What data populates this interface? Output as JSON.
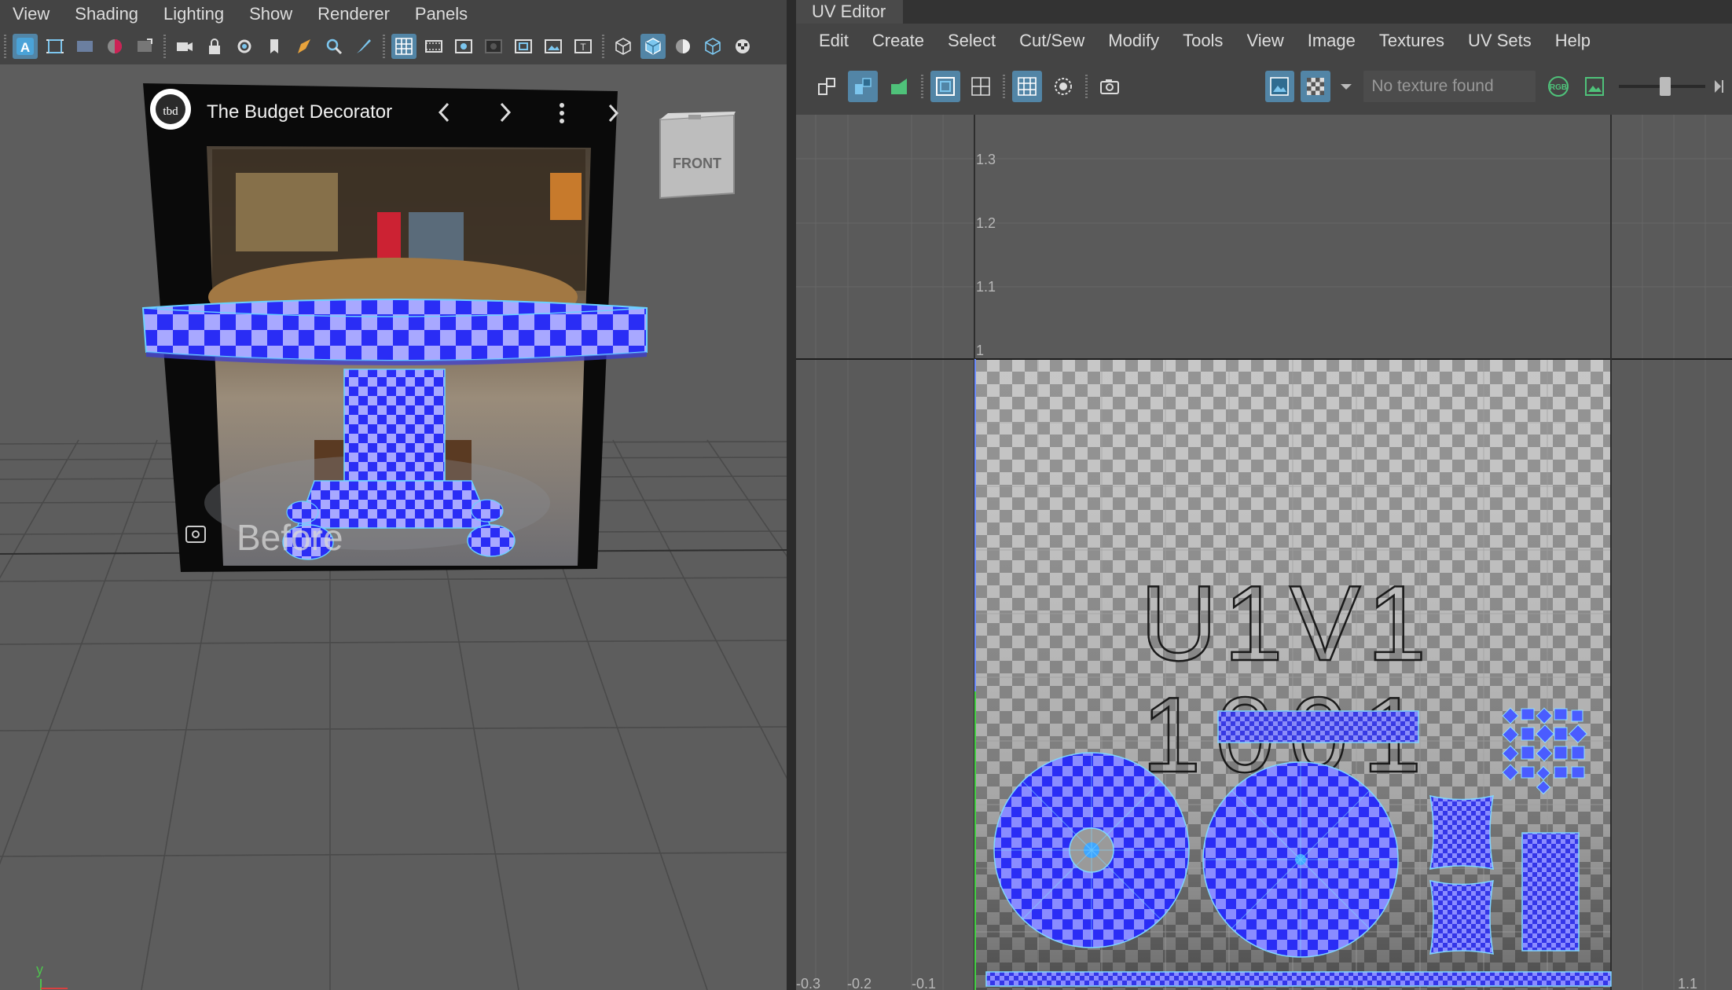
{
  "left_panel": {
    "menu": [
      "View",
      "Shading",
      "Lighting",
      "Show",
      "Renderer",
      "Panels"
    ],
    "image_plane": {
      "channel_title": "The Budget Decorator",
      "channel_logo": "tbd",
      "overlay_text": "Before"
    },
    "view_cube_label": "FRONT",
    "axis_label": "y"
  },
  "right_panel": {
    "tab_label": "UV Editor",
    "menu": [
      "Edit",
      "Create",
      "Select",
      "Cut/Sew",
      "Modify",
      "Tools",
      "View",
      "Image",
      "Textures",
      "UV Sets",
      "Help"
    ],
    "texture_field_placeholder": "No texture found",
    "channel_button_label": "RGB",
    "v_axis_ticks": [
      "1.3",
      "1.2",
      "1.1",
      "1"
    ],
    "u_axis_ticks": [
      "-0.3",
      "-0.2",
      "-0.1",
      "1.1"
    ],
    "tile_label": "U1V1",
    "tile_number": "1001"
  },
  "colors": {
    "accent": "#5285a6",
    "checker_blue": "#2a2df5",
    "checker_light": "#a8a8ff",
    "background": "#444444"
  }
}
